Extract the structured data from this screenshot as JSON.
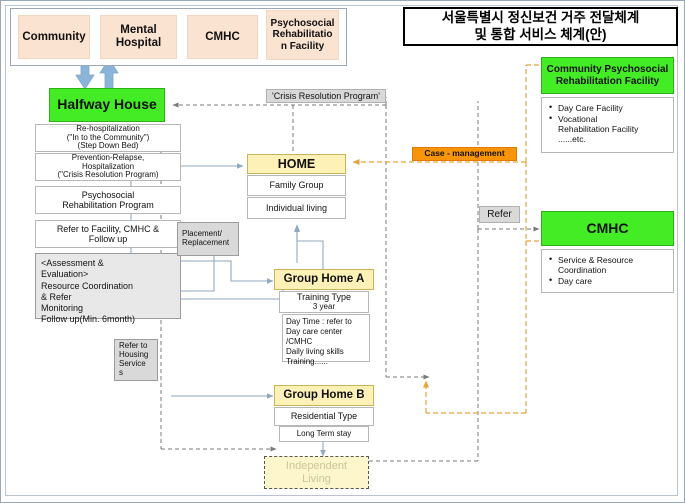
{
  "title": {
    "line1": "서울특별시 정신보건 거주 전달체계",
    "line2": "및 통합 서비스 체계(안)"
  },
  "top_row": [
    {
      "label": "Community"
    },
    {
      "label": "Mental\nHospital"
    },
    {
      "label": "CMHC"
    },
    {
      "label": "Psychosocial\nRehabilitatio\nn Facility"
    }
  ],
  "halfway": {
    "header": "Halfway House",
    "rows": [
      "Re-hospitalization\n(\"In to the Community\")\n(Step Down Bed)",
      "Prevention-Relapse,\nHospitalization\n(\"Crisis Resolution Program)",
      "Psychosocial\nRehabilitation Program",
      "Refer to Facility, CMHC &\nFollow up"
    ],
    "assessment": "<Assessment  &\nEvaluation>\nResource Coordination\n& Refer\nMonitoring\nFollow up(Min. 6month)"
  },
  "labels": {
    "crisis_resolution": "'Crisis Resolution Program'",
    "case_management": "Case - management",
    "refer": "Refer",
    "placement": "Placement/\nReplacement",
    "refer_housing": "Refer to\nHousing\nService\ns"
  },
  "home": {
    "header": "HOME",
    "rows": [
      "Family Group",
      "Individual living"
    ]
  },
  "group_home_a": {
    "header": "Group Home A",
    "type_line": "Training Type",
    "type_sub": "3 year",
    "details": "Day Time : refer  to\nDay care center\n/CMHC\nDaily living skills\nTraining......"
  },
  "group_home_b": {
    "header": "Group Home B",
    "rows": [
      "Residential Type",
      "Long Term stay"
    ]
  },
  "independent_living": {
    "label": "Independent\nLiving"
  },
  "community_psr": {
    "header": "Community  Psychosocial\nRehabilitation  Facility",
    "items": [
      "Day Care Facility",
      "Vocational\nRehabilitation  Facility\n......etc."
    ]
  },
  "cmhc": {
    "header": "CMHC",
    "items": [
      "Service &  Resource\nCoordination",
      "Day care"
    ]
  },
  "colors": {
    "green": "#44ec25",
    "yellow": "#fdf1b8",
    "peach": "#fbe3d2",
    "orange": "#f89406",
    "gray": "#d9d9d9",
    "connector_blue": "#8fa8bf",
    "connector_orange": "#e8a33d",
    "connector_gray": "#7a7a7a"
  }
}
